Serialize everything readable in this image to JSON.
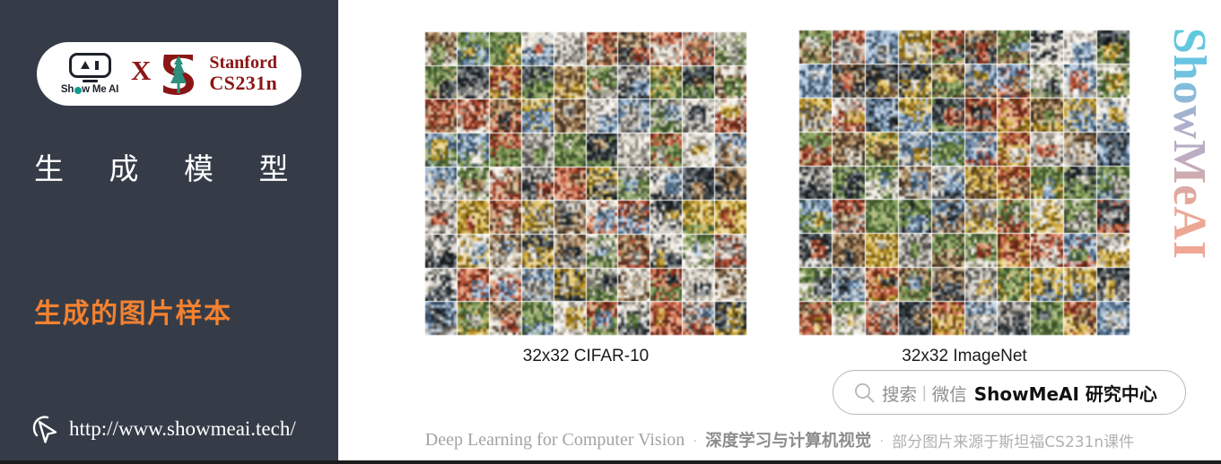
{
  "sidebar": {
    "background_color": "#353c48",
    "logo": {
      "showmeai_wordmark_pre": "Sh",
      "showmeai_wordmark_post": "w Me AI",
      "robot_icon_name": "showmeai-robot-icon",
      "cross_label": "X",
      "stanford_s_icon_name": "stanford-tree-s-icon",
      "stanford_line1": "Stanford",
      "stanford_line2": "CS231n",
      "stanford_color": "#8c1515",
      "tree_color": "#2f8f7d"
    },
    "title": "生 成 模 型",
    "subtitle": "生成的图片样本",
    "subtitle_color": "#f5812f",
    "url": "http://www.showmeai.tech/",
    "cursor_icon_name": "mouse-pointer-icon"
  },
  "content": {
    "figures": [
      {
        "id": "cifar",
        "caption": "32x32 CIFAR-10",
        "grid_cols": 10,
        "grid_rows": 9
      },
      {
        "id": "imagenet",
        "caption": "32x32 ImageNet",
        "grid_cols": 10,
        "grid_rows": 9
      }
    ],
    "watermark": "ShowMeAI",
    "search_bar": {
      "icon_name": "magnifier-icon",
      "label": "搜索",
      "divider": "|",
      "channel": "微信",
      "brand": "ShowMeAI 研究中心"
    },
    "footer": {
      "english": "Deep Learning for Computer Vision",
      "separator": "·",
      "chinese_bold": "深度学习与计算机视觉",
      "chinese_note": "部分图片来源于斯坦福CS231n课件"
    }
  }
}
